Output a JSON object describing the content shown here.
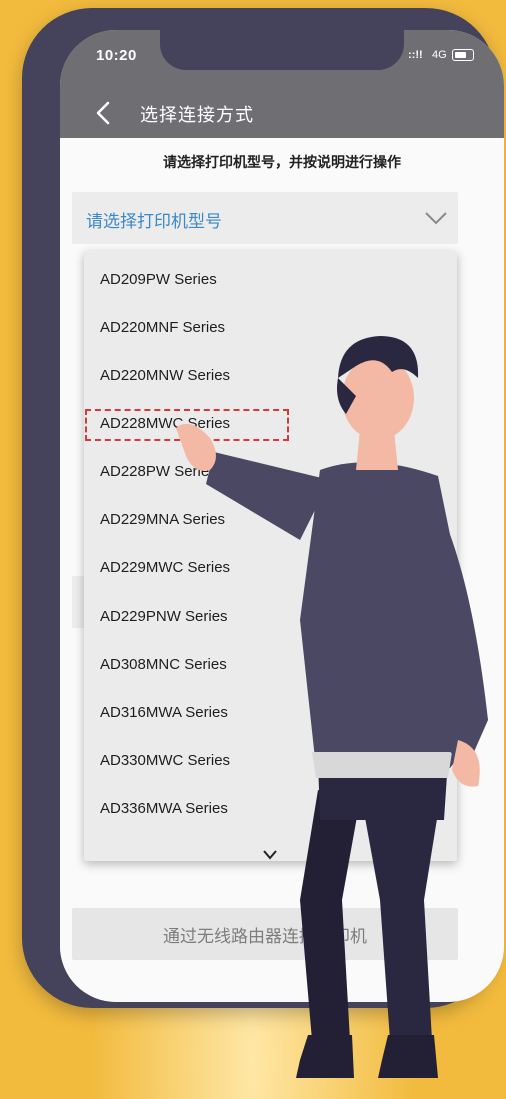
{
  "status_bar": {
    "time": "10:20",
    "signal": "::!!",
    "network": "4G"
  },
  "header": {
    "title": "选择连接方式"
  },
  "instruction": "请选择打印机型号，并按说明进行操作",
  "model_select": {
    "placeholder": "请选择打印机型号"
  },
  "dropdown": {
    "options": [
      "AD209PW Series",
      "AD220MNF Series",
      "AD220MNW Series",
      "AD228MWC Series",
      "AD228PW Series",
      "AD229MNA Series",
      "AD229MWC Series",
      "AD229PNW Series",
      "AD308MNC Series",
      "AD316MWA Series",
      "AD330MWC Series",
      "AD336MWA Series"
    ],
    "highlighted_option": "AD228MWC Series"
  },
  "wifi_button": {
    "label": "通过无线路由器连接打印机"
  },
  "colors": {
    "background": "#f2bb3e",
    "phone_frame": "#45425c",
    "nav_bar": "#6f6f73",
    "accent_link": "#3b88c9",
    "highlight_border": "#d9363e"
  },
  "icons": [
    "back-icon",
    "chevron-down-icon",
    "battery-icon",
    "scroll-chevron-icon"
  ]
}
